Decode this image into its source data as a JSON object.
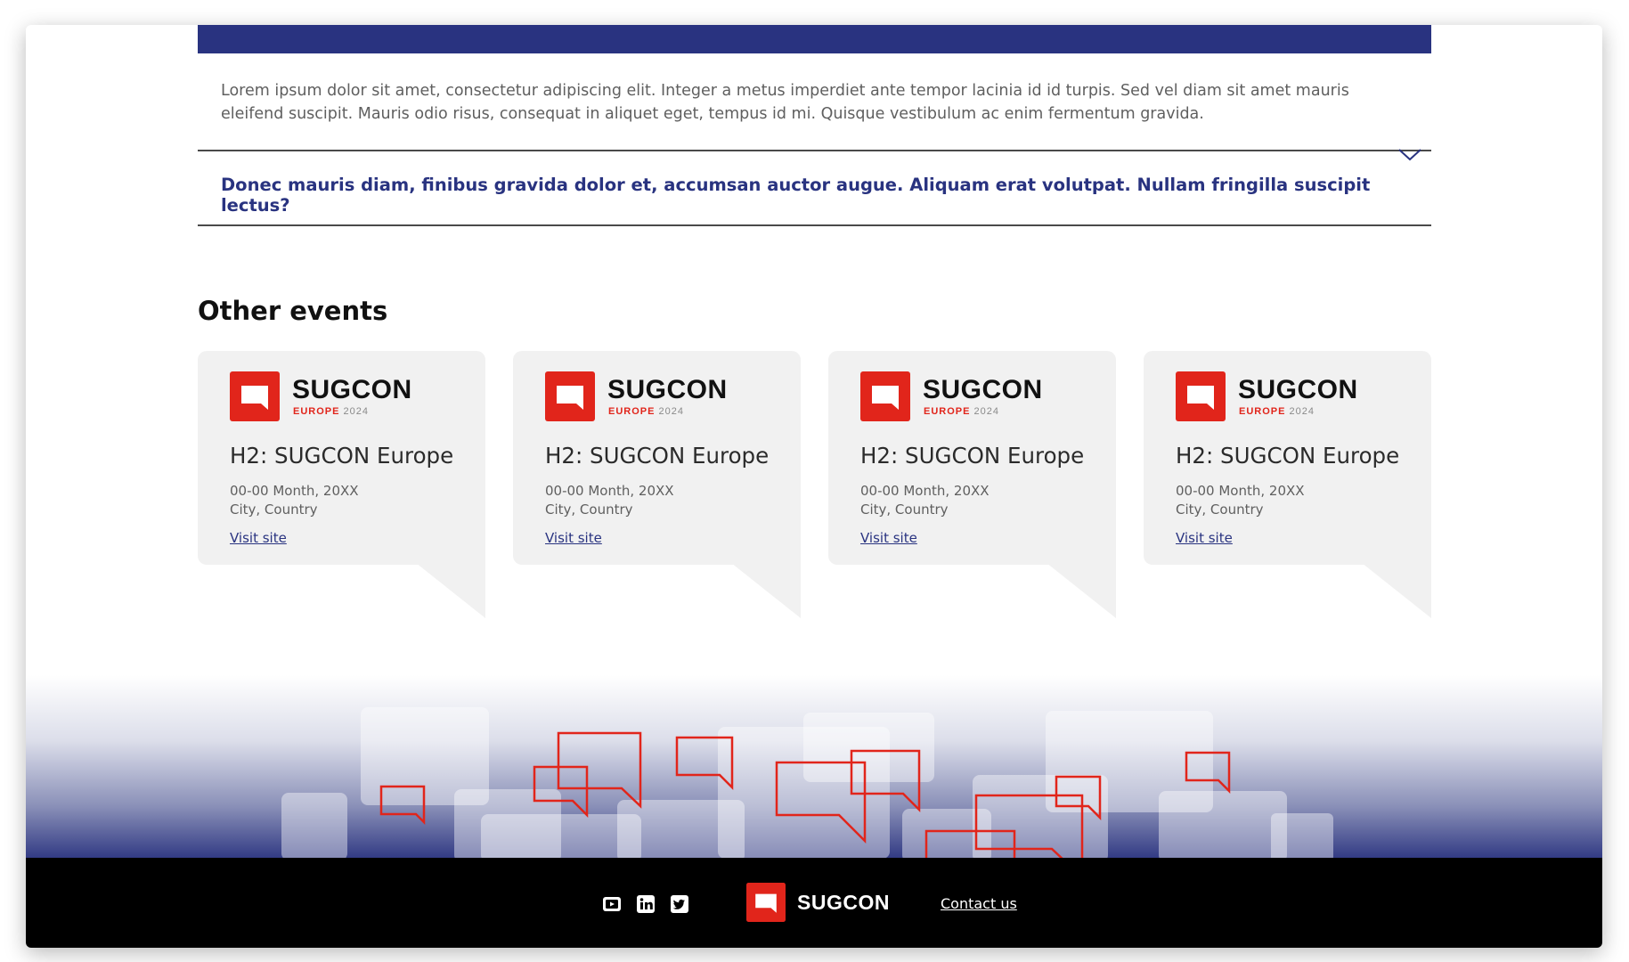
{
  "faq": {
    "answer": "Lorem ipsum dolor sit amet, consectetur adipiscing elit. Integer a metus imperdiet ante tempor lacinia id id turpis. Sed vel diam sit amet mauris eleifend suscipit. Mauris odio risus, consequat in aliquet eget, tempus id mi. Quisque vestibulum ac enim fermentum gravida.",
    "question": "Donec mauris diam, finibus gravida dolor et, accumsan auctor augue. Aliquam erat volutpat. Nullam fringilla suscipit lectus?",
    "chevron_icon": "chevron-down-icon"
  },
  "other_events": {
    "title": "Other events",
    "cards": [
      {
        "logo_word": "SUGCON",
        "logo_sub_europe": "EUROPE",
        "logo_sub_year": "2024",
        "title": "H2: SUGCON Europe",
        "date": "00-00 Month, 20XX",
        "location": "City, Country",
        "link": "Visit site"
      },
      {
        "logo_word": "SUGCON",
        "logo_sub_europe": "EUROPE",
        "logo_sub_year": "2024",
        "title": "H2: SUGCON Europe",
        "date": "00-00 Month, 20XX",
        "location": "City, Country",
        "link": "Visit site"
      },
      {
        "logo_word": "SUGCON",
        "logo_sub_europe": "EUROPE",
        "logo_sub_year": "2024",
        "title": "H2: SUGCON Europe",
        "date": "00-00 Month, 20XX",
        "location": "City, Country",
        "link": "Visit site"
      },
      {
        "logo_word": "SUGCON",
        "logo_sub_europe": "EUROPE",
        "logo_sub_year": "2024",
        "title": "H2: SUGCON Europe",
        "date": "00-00 Month, 20XX",
        "location": "City, Country",
        "link": "Visit site"
      }
    ]
  },
  "footer": {
    "social_icons": [
      "youtube-icon",
      "linkedin-icon",
      "twitter-icon"
    ],
    "logo_word": "SUGCON",
    "contact_link": "Contact us"
  },
  "colors": {
    "brand_navy": "#293380",
    "brand_red": "#e1251b",
    "card_bg": "#f1f1f1",
    "footer_bg": "#000000"
  }
}
